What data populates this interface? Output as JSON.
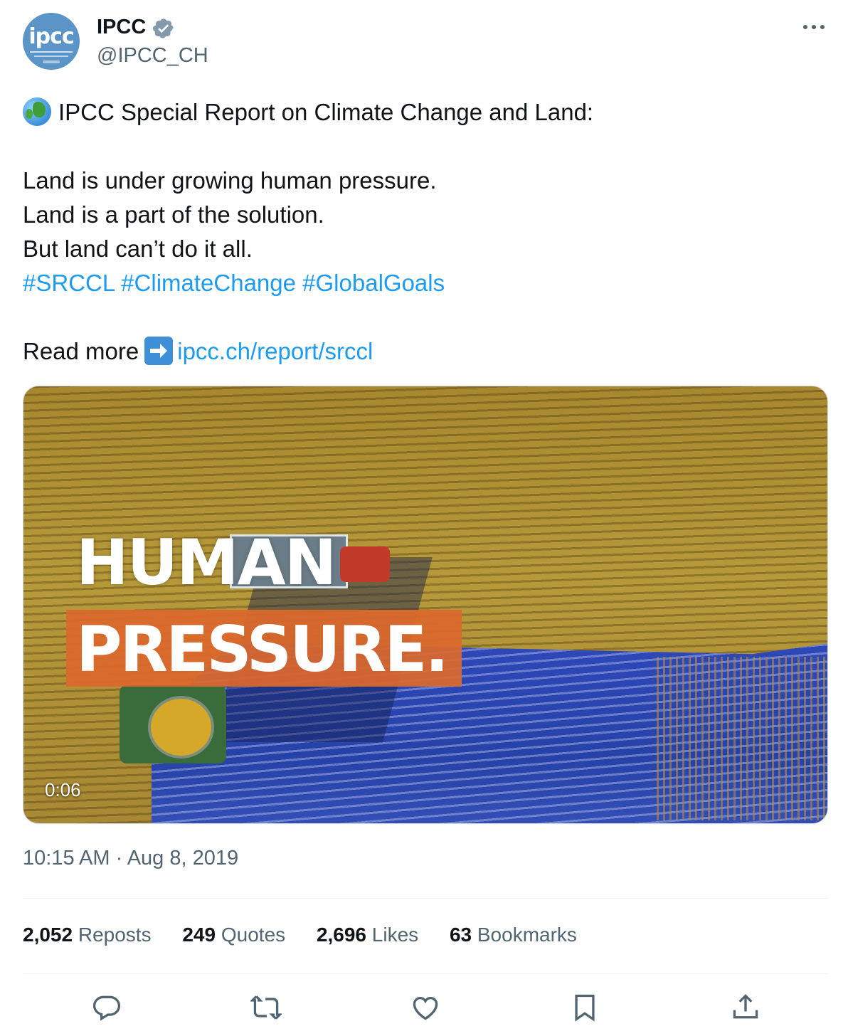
{
  "author": {
    "name": "IPCC",
    "handle": "@IPCC_CH",
    "avatar_text": "ipcc",
    "verified_icon": "verified-badge-icon"
  },
  "tweet": {
    "line1": "IPCC Special Report on Climate Change and Land:",
    "line2": "Land is under growing human pressure.",
    "line3": "Land is a part of the solution.",
    "line4": "But land can’t do it all.",
    "hashtags": [
      "#SRCCL",
      "#ClimateChange",
      "#GlobalGoals"
    ],
    "read_more_label": "Read more",
    "link": "ipcc.ch/report/srccl"
  },
  "media": {
    "headline_top": "HUMAN",
    "headline_bottom": "PRESSURE.",
    "duration": "0:06"
  },
  "meta": {
    "timestamp": "10:15 AM · Aug 8, 2019"
  },
  "stats": [
    {
      "count": "2,052",
      "label": "Reposts"
    },
    {
      "count": "249",
      "label": "Quotes"
    },
    {
      "count": "2,696",
      "label": "Likes"
    },
    {
      "count": "63",
      "label": "Bookmarks"
    }
  ],
  "colors": {
    "link": "#1d9bf0",
    "text": "#0f1419",
    "secondary": "#536471",
    "accent_orange": "#db682c"
  },
  "actions": [
    "reply-icon",
    "repost-icon",
    "like-icon",
    "bookmark-icon",
    "share-icon"
  ]
}
